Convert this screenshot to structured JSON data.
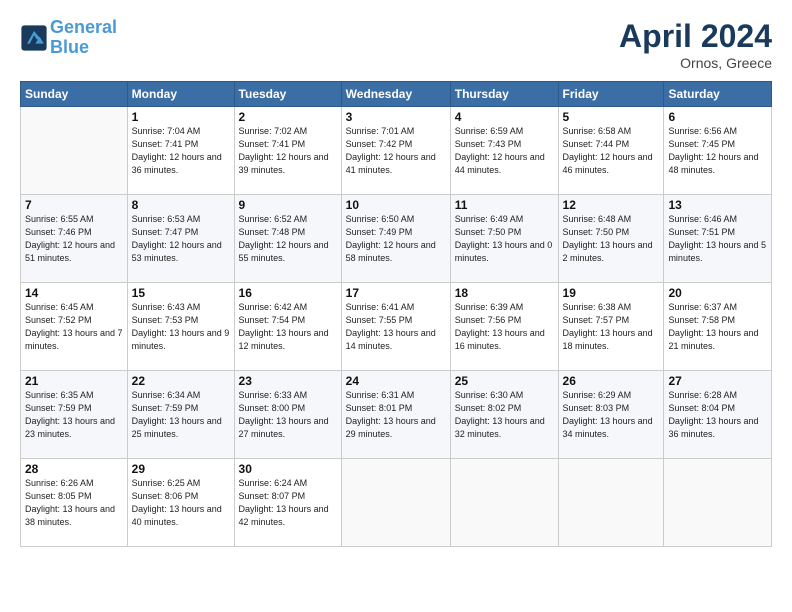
{
  "logo": {
    "line1": "General",
    "line2": "Blue"
  },
  "title": "April 2024",
  "subtitle": "Ornos, Greece",
  "headers": [
    "Sunday",
    "Monday",
    "Tuesday",
    "Wednesday",
    "Thursday",
    "Friday",
    "Saturday"
  ],
  "weeks": [
    [
      {
        "day": "",
        "sunrise": "",
        "sunset": "",
        "daylight": ""
      },
      {
        "day": "1",
        "sunrise": "Sunrise: 7:04 AM",
        "sunset": "Sunset: 7:41 PM",
        "daylight": "Daylight: 12 hours and 36 minutes."
      },
      {
        "day": "2",
        "sunrise": "Sunrise: 7:02 AM",
        "sunset": "Sunset: 7:41 PM",
        "daylight": "Daylight: 12 hours and 39 minutes."
      },
      {
        "day": "3",
        "sunrise": "Sunrise: 7:01 AM",
        "sunset": "Sunset: 7:42 PM",
        "daylight": "Daylight: 12 hours and 41 minutes."
      },
      {
        "day": "4",
        "sunrise": "Sunrise: 6:59 AM",
        "sunset": "Sunset: 7:43 PM",
        "daylight": "Daylight: 12 hours and 44 minutes."
      },
      {
        "day": "5",
        "sunrise": "Sunrise: 6:58 AM",
        "sunset": "Sunset: 7:44 PM",
        "daylight": "Daylight: 12 hours and 46 minutes."
      },
      {
        "day": "6",
        "sunrise": "Sunrise: 6:56 AM",
        "sunset": "Sunset: 7:45 PM",
        "daylight": "Daylight: 12 hours and 48 minutes."
      }
    ],
    [
      {
        "day": "7",
        "sunrise": "Sunrise: 6:55 AM",
        "sunset": "Sunset: 7:46 PM",
        "daylight": "Daylight: 12 hours and 51 minutes."
      },
      {
        "day": "8",
        "sunrise": "Sunrise: 6:53 AM",
        "sunset": "Sunset: 7:47 PM",
        "daylight": "Daylight: 12 hours and 53 minutes."
      },
      {
        "day": "9",
        "sunrise": "Sunrise: 6:52 AM",
        "sunset": "Sunset: 7:48 PM",
        "daylight": "Daylight: 12 hours and 55 minutes."
      },
      {
        "day": "10",
        "sunrise": "Sunrise: 6:50 AM",
        "sunset": "Sunset: 7:49 PM",
        "daylight": "Daylight: 12 hours and 58 minutes."
      },
      {
        "day": "11",
        "sunrise": "Sunrise: 6:49 AM",
        "sunset": "Sunset: 7:50 PM",
        "daylight": "Daylight: 13 hours and 0 minutes."
      },
      {
        "day": "12",
        "sunrise": "Sunrise: 6:48 AM",
        "sunset": "Sunset: 7:50 PM",
        "daylight": "Daylight: 13 hours and 2 minutes."
      },
      {
        "day": "13",
        "sunrise": "Sunrise: 6:46 AM",
        "sunset": "Sunset: 7:51 PM",
        "daylight": "Daylight: 13 hours and 5 minutes."
      }
    ],
    [
      {
        "day": "14",
        "sunrise": "Sunrise: 6:45 AM",
        "sunset": "Sunset: 7:52 PM",
        "daylight": "Daylight: 13 hours and 7 minutes."
      },
      {
        "day": "15",
        "sunrise": "Sunrise: 6:43 AM",
        "sunset": "Sunset: 7:53 PM",
        "daylight": "Daylight: 13 hours and 9 minutes."
      },
      {
        "day": "16",
        "sunrise": "Sunrise: 6:42 AM",
        "sunset": "Sunset: 7:54 PM",
        "daylight": "Daylight: 13 hours and 12 minutes."
      },
      {
        "day": "17",
        "sunrise": "Sunrise: 6:41 AM",
        "sunset": "Sunset: 7:55 PM",
        "daylight": "Daylight: 13 hours and 14 minutes."
      },
      {
        "day": "18",
        "sunrise": "Sunrise: 6:39 AM",
        "sunset": "Sunset: 7:56 PM",
        "daylight": "Daylight: 13 hours and 16 minutes."
      },
      {
        "day": "19",
        "sunrise": "Sunrise: 6:38 AM",
        "sunset": "Sunset: 7:57 PM",
        "daylight": "Daylight: 13 hours and 18 minutes."
      },
      {
        "day": "20",
        "sunrise": "Sunrise: 6:37 AM",
        "sunset": "Sunset: 7:58 PM",
        "daylight": "Daylight: 13 hours and 21 minutes."
      }
    ],
    [
      {
        "day": "21",
        "sunrise": "Sunrise: 6:35 AM",
        "sunset": "Sunset: 7:59 PM",
        "daylight": "Daylight: 13 hours and 23 minutes."
      },
      {
        "day": "22",
        "sunrise": "Sunrise: 6:34 AM",
        "sunset": "Sunset: 7:59 PM",
        "daylight": "Daylight: 13 hours and 25 minutes."
      },
      {
        "day": "23",
        "sunrise": "Sunrise: 6:33 AM",
        "sunset": "Sunset: 8:00 PM",
        "daylight": "Daylight: 13 hours and 27 minutes."
      },
      {
        "day": "24",
        "sunrise": "Sunrise: 6:31 AM",
        "sunset": "Sunset: 8:01 PM",
        "daylight": "Daylight: 13 hours and 29 minutes."
      },
      {
        "day": "25",
        "sunrise": "Sunrise: 6:30 AM",
        "sunset": "Sunset: 8:02 PM",
        "daylight": "Daylight: 13 hours and 32 minutes."
      },
      {
        "day": "26",
        "sunrise": "Sunrise: 6:29 AM",
        "sunset": "Sunset: 8:03 PM",
        "daylight": "Daylight: 13 hours and 34 minutes."
      },
      {
        "day": "27",
        "sunrise": "Sunrise: 6:28 AM",
        "sunset": "Sunset: 8:04 PM",
        "daylight": "Daylight: 13 hours and 36 minutes."
      }
    ],
    [
      {
        "day": "28",
        "sunrise": "Sunrise: 6:26 AM",
        "sunset": "Sunset: 8:05 PM",
        "daylight": "Daylight: 13 hours and 38 minutes."
      },
      {
        "day": "29",
        "sunrise": "Sunrise: 6:25 AM",
        "sunset": "Sunset: 8:06 PM",
        "daylight": "Daylight: 13 hours and 40 minutes."
      },
      {
        "day": "30",
        "sunrise": "Sunrise: 6:24 AM",
        "sunset": "Sunset: 8:07 PM",
        "daylight": "Daylight: 13 hours and 42 minutes."
      },
      {
        "day": "",
        "sunrise": "",
        "sunset": "",
        "daylight": ""
      },
      {
        "day": "",
        "sunrise": "",
        "sunset": "",
        "daylight": ""
      },
      {
        "day": "",
        "sunrise": "",
        "sunset": "",
        "daylight": ""
      },
      {
        "day": "",
        "sunrise": "",
        "sunset": "",
        "daylight": ""
      }
    ]
  ]
}
